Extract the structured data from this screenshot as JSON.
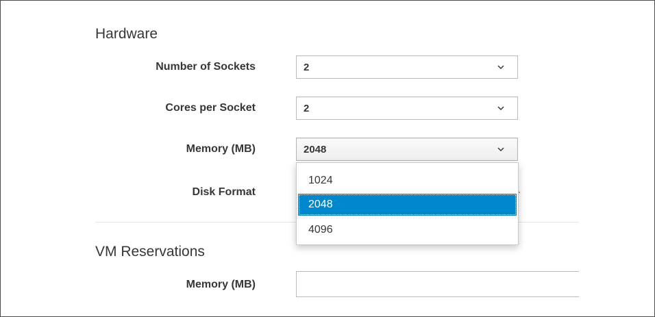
{
  "hardware": {
    "title": "Hardware",
    "sockets": {
      "label": "Number of Sockets",
      "value": "2",
      "icon": "chevron-down-icon"
    },
    "cores": {
      "label": "Cores per Socket",
      "value": "2",
      "icon": "chevron-down-icon"
    },
    "memory": {
      "label": "Memory (MB)",
      "value": "2048",
      "icon": "chevron-down-icon",
      "options": [
        "1024",
        "2048",
        "4096"
      ],
      "selected_option": "2048"
    },
    "disk_format": {
      "label": "Disk Format"
    }
  },
  "reservations": {
    "title": "VM Reservations",
    "memory": {
      "label": "Memory (MB)",
      "value": ""
    }
  },
  "colors": {
    "selection": "#0088ce",
    "text": "#363636",
    "border": "#bbbbbb"
  }
}
